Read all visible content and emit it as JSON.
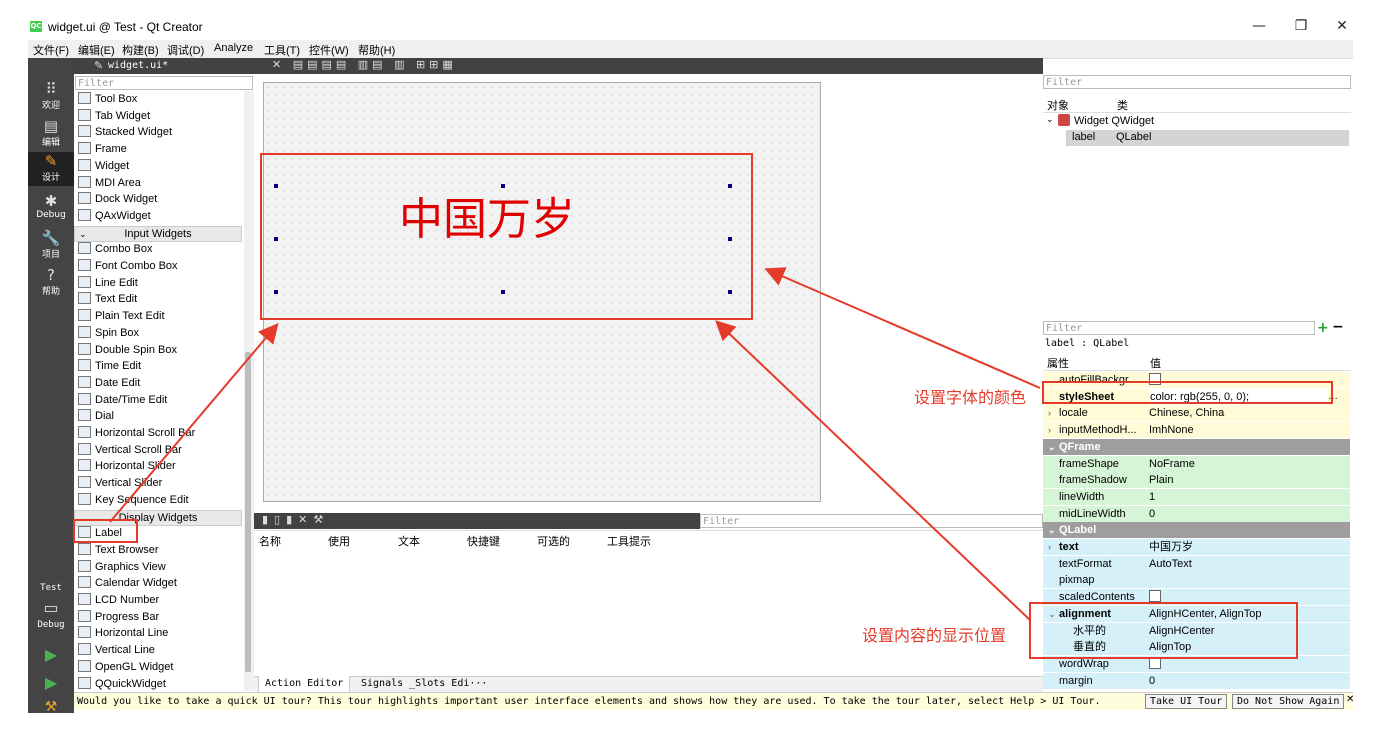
{
  "window": {
    "title": "widget.ui @ Test - Qt Creator",
    "app_icon_text": "QC",
    "controls": [
      "—",
      "❐",
      "✕"
    ]
  },
  "menu": [
    "文件(F)",
    "编辑(E)",
    "构建(B)",
    "调试(D)",
    "Analyze",
    "工具(T)",
    "控件(W)",
    "帮助(H)"
  ],
  "modes": [
    {
      "icon": "grid-icon",
      "glyph": "⠿",
      "label": "欢迎"
    },
    {
      "icon": "edit-icon",
      "glyph": "▤",
      "label": "编辑"
    },
    {
      "icon": "design-icon",
      "glyph": "✎",
      "label": "设计"
    },
    {
      "icon": "debug-icon",
      "glyph": "✱",
      "label": "Debug"
    },
    {
      "icon": "project-icon",
      "glyph": "🔧",
      "label": "项目"
    },
    {
      "icon": "help-icon",
      "glyph": "?",
      "label": "帮助"
    }
  ],
  "target": {
    "project": "Test",
    "config": "Debug"
  },
  "editor": {
    "file_tab": "widget.ui*",
    "filter_placeholder": "Filter"
  },
  "widget_box": {
    "items_a": [
      "Tool Box",
      "Tab Widget",
      "Stacked Widget",
      "Frame",
      "Widget",
      "MDI Area",
      "Dock Widget",
      "QAxWidget"
    ],
    "cat_input": "Input Widgets",
    "items_b": [
      "Combo Box",
      "Font Combo Box",
      "Line Edit",
      "Text Edit",
      "Plain Text Edit",
      "Spin Box",
      "Double Spin Box",
      "Time Edit",
      "Date Edit",
      "Date/Time Edit",
      "Dial",
      "Horizontal Scroll Bar",
      "Vertical Scroll Bar",
      "Horizontal Slider",
      "Vertical Slider",
      "Key Sequence Edit"
    ],
    "cat_display": "Display Widgets",
    "items_c": [
      "Label",
      "Text Browser",
      "Graphics View",
      "Calendar Widget",
      "LCD Number",
      "Progress Bar",
      "Horizontal Line",
      "Vertical Line",
      "OpenGL Widget",
      "QQuickWidget"
    ]
  },
  "form": {
    "label_text": "中国万岁",
    "label_color": "#e00000"
  },
  "action_editor": {
    "filter": "Filter",
    "columns": [
      "名称",
      "使用",
      "文本",
      "快捷键",
      "可选的",
      "工具提示"
    ],
    "tabs": [
      "Action Editor",
      "Signals _Slots Edi···"
    ]
  },
  "object_inspector": {
    "filter": "Filter",
    "col_object": "对象",
    "col_class": "类",
    "rows": [
      {
        "name": "Widget",
        "cls": "QWidget"
      },
      {
        "name": "label",
        "cls": "QLabel"
      }
    ]
  },
  "property_editor": {
    "filter": "Filter",
    "object_line": "label : QLabel",
    "col_prop": "属性",
    "col_value": "值",
    "rows": [
      {
        "name": "autoFillBackgr...",
        "value": "",
        "checkbox": true,
        "bg": "#fffbd6"
      },
      {
        "name": "styleSheet",
        "value": "color: rgb(255, 0, 0);",
        "bold": true,
        "bg": "#fffbd6",
        "edit": true
      },
      {
        "name": "locale",
        "value": "Chinese, China",
        "expander": "›",
        "bg": "#fffbd6"
      },
      {
        "name": "inputMethodH...",
        "value": "ImhNone",
        "expander": "›",
        "bg": "#fffbd6"
      },
      {
        "name": "QFrame",
        "cat": true
      },
      {
        "name": "frameShape",
        "value": "NoFrame",
        "bg": "#d6f5d6"
      },
      {
        "name": "frameShadow",
        "value": "Plain",
        "bg": "#d6f5d6"
      },
      {
        "name": "lineWidth",
        "value": "1",
        "bg": "#d6f5d6"
      },
      {
        "name": "midLineWidth",
        "value": "0",
        "bg": "#d6f5d6"
      },
      {
        "name": "QLabel",
        "cat": true
      },
      {
        "name": "text",
        "value": "中国万岁",
        "bold": true,
        "expander": "›",
        "bg": "#d6f0fa"
      },
      {
        "name": "textFormat",
        "value": "AutoText",
        "bg": "#d6f0fa"
      },
      {
        "name": "pixmap",
        "value": "",
        "bg": "#d6f0fa"
      },
      {
        "name": "scaledContents",
        "value": "",
        "checkbox": true,
        "bg": "#d6f0fa"
      },
      {
        "name": "alignment",
        "value": "AlignHCenter, AlignTop",
        "bold": true,
        "expander": "⌄",
        "bg": "#d6f0fa"
      },
      {
        "name": "水平的",
        "value": "AlignHCenter",
        "indent": true,
        "bg": "#d6f0fa"
      },
      {
        "name": "垂直的",
        "value": "AlignTop",
        "indent": true,
        "bg": "#d6f0fa"
      },
      {
        "name": "wordWrap",
        "value": "",
        "checkbox": true,
        "bg": "#d6f0fa"
      },
      {
        "name": "margin",
        "value": "0",
        "bg": "#d6f0fa"
      }
    ]
  },
  "status": {
    "message": "Would you like to take a quick UI tour? This tour highlights important user interface elements and shows how they are used. To take the tour later, select Help > UI Tour.",
    "take_tour": "Take UI Tour",
    "dont_show": "Do Not Show Again",
    "close": "✕"
  },
  "annotations": {
    "font_color": "设置字体的颜色",
    "alignment": "设置内容的显示位置"
  },
  "colors": {
    "annotation_red": "#e53a2a",
    "qframe_green": "#d6f5d6",
    "qlabel_blue": "#d6f0fa",
    "qwidget_yellow": "#fffbd6"
  }
}
